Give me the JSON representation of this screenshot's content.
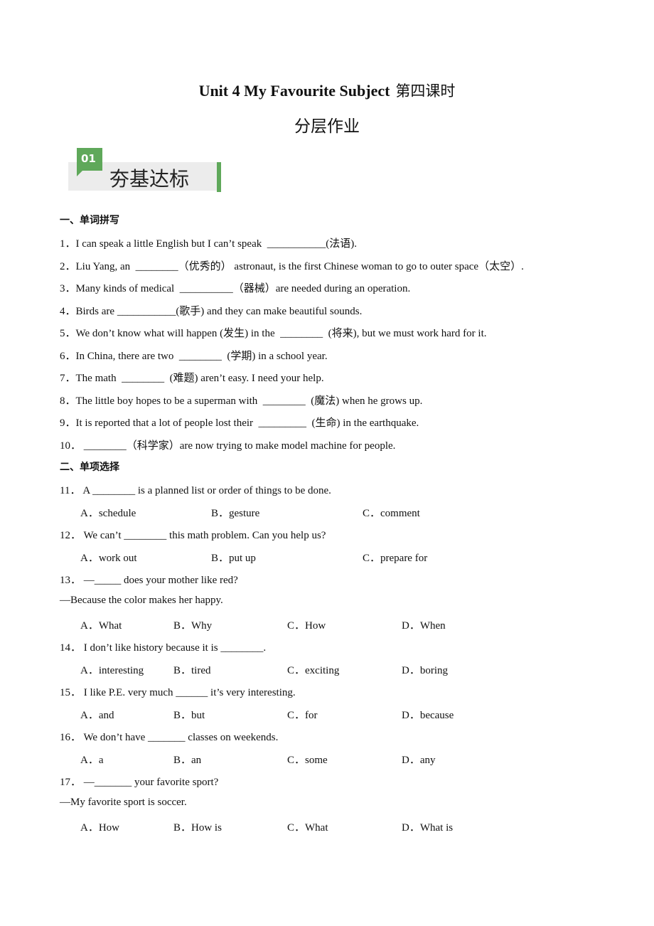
{
  "header": {
    "title_en": "Unit 4 My Favourite Subject",
    "title_cn": "第四课时",
    "subtitle": "分层作业"
  },
  "banner": {
    "number": "01",
    "label": "夯基达标",
    "accent_color": "#5fa85a"
  },
  "section1": {
    "heading": "一、单词拼写",
    "items": [
      "1．I can speak a little English but I can’t speak  ___________(法语).",
      "2．Liu Yang, an  ________（优秀的） astronaut, is the first Chinese woman to go to outer space（太空）.",
      "3．Many kinds of medical  __________（器械）are needed during an operation.",
      "4．Birds are ___________(歌手) and they can make beautiful sounds.",
      "5．We don’t know what will happen (发生) in the  ________  (将来), but we must work hard for it.",
      "6．In China, there are two  ________  (学期) in a school year.",
      "7．The math  ________  (难题) aren’t easy. I need your help.",
      "8．The little boy hopes to be a superman with  ________  (魔法) when he grows up.",
      "9．It is reported that a lot of people lost their  _________  (生命) in the earthquake.",
      "10． ________（科学家）are now trying to make model machine for people."
    ]
  },
  "section2": {
    "heading": "二、单项选择",
    "questions": [
      {
        "stem": "11． A ________ is a planned list or order of things to be done.",
        "options": [
          "A．schedule",
          "B．gesture",
          "C．comment"
        ]
      },
      {
        "stem": "12． We can’t ________ this math problem. Can you help us?",
        "options": [
          "A．work out",
          "B．put up",
          "C．prepare for"
        ]
      },
      {
        "stem": "13． —_____ does your mother like red?",
        "reply": "—Because the color makes her happy.",
        "options": [
          "A．What",
          "B．Why",
          "C．How",
          "D．When"
        ]
      },
      {
        "stem": "14． I don’t like history because it is ________.",
        "options": [
          "A．interesting",
          "B．tired",
          "C．exciting",
          "D．boring"
        ]
      },
      {
        "stem": "15． I like P.E. very much ______ it’s very interesting.",
        "options": [
          "A．and",
          "B．but",
          "C．for",
          "D．because"
        ]
      },
      {
        "stem": "16． We don’t have _______ classes on weekends.",
        "options": [
          "A．a",
          "B．an",
          "C．some",
          "D．any"
        ]
      },
      {
        "stem": "17． —_______ your favorite sport?",
        "reply": "—My favorite sport is soccer.",
        "options": [
          "A．How",
          "B．How is",
          "C．What",
          "D．What is"
        ]
      }
    ]
  }
}
